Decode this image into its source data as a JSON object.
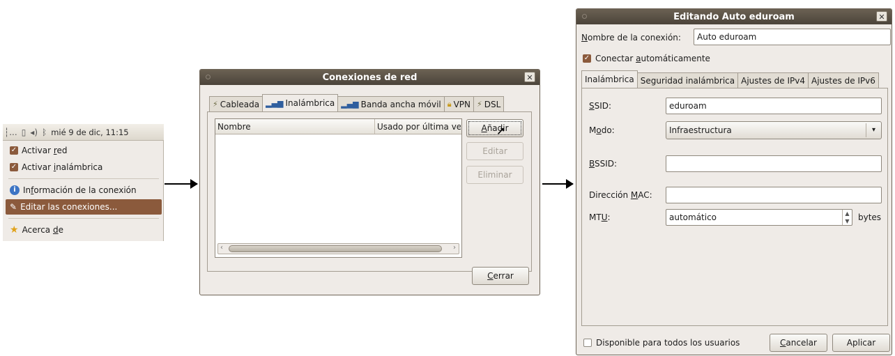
{
  "panel": {
    "tray_network_glyph": "┆",
    "tray_dots": "...",
    "clock": "mié 9 de dic, 11:15",
    "menu": {
      "enable_network": {
        "pre": "Activar ",
        "mn": "r",
        "post": "ed",
        "checked": true
      },
      "enable_wireless": {
        "pre": "Activar ",
        "mn": "i",
        "post": "nalámbrica",
        "checked": true
      },
      "connection_info": {
        "pre": "In",
        "mn": "f",
        "post": "ormación de la conexión"
      },
      "edit_connections": {
        "label": "Editar las conexiones..."
      },
      "about": {
        "pre": "Acerca ",
        "mn": "d",
        "post": "e"
      }
    }
  },
  "network_connections": {
    "title": "Conexiones de red",
    "tabs": [
      {
        "label": "Cableada",
        "icon": "wired-icon"
      },
      {
        "label": "Inalámbrica",
        "icon": "wireless-signal-icon",
        "active": true
      },
      {
        "label": "Banda ancha móvil",
        "icon": "mobile-signal-icon"
      },
      {
        "label": "VPN",
        "icon": "lock-icon"
      },
      {
        "label": "DSL",
        "icon": "wired-icon"
      }
    ],
    "columns": {
      "name": "Nombre",
      "last_used": "Usado por última ve"
    },
    "buttons": {
      "add": {
        "mn": "A",
        "post": "ñadir"
      },
      "edit": "Editar",
      "delete": "Eliminar",
      "close": {
        "mn": "C",
        "post": "errar"
      }
    }
  },
  "edit_dialog": {
    "title": "Editando Auto eduroam",
    "connection_name": {
      "mn": "N",
      "post": "ombre de la conexión:",
      "value": "Auto eduroam"
    },
    "autoconnect": {
      "pre": "Conectar ",
      "mn": "a",
      "post": "utomáticamente",
      "checked": true
    },
    "tabs": [
      "Inalámbrica",
      "Seguridad inalámbrica",
      "Ajustes de IPv4",
      "Ajustes de IPv6"
    ],
    "ssid": {
      "mn": "S",
      "post": "SID:",
      "value": "eduroam"
    },
    "mode": {
      "pre": "M",
      "mn": "o",
      "post": "do:",
      "value": "Infraestructura"
    },
    "bssid": {
      "mn": "B",
      "post": "SSID:",
      "value": ""
    },
    "mac": {
      "pre": "Dirección ",
      "mn": "M",
      "post": "AC:",
      "value": ""
    },
    "mtu": {
      "pre": "MT",
      "mn": "U",
      "post": ":",
      "value": "automático",
      "unit": "bytes"
    },
    "all_users": {
      "label": "Disponible para todos los usuarios",
      "checked": false
    },
    "buttons": {
      "cancel": {
        "mn": "C",
        "post": "ancelar"
      },
      "apply": "Aplicar"
    }
  },
  "colors": {
    "accent": "#8b5a3c",
    "titlebar": "#4b443a",
    "window_bg": "#efebe7"
  }
}
